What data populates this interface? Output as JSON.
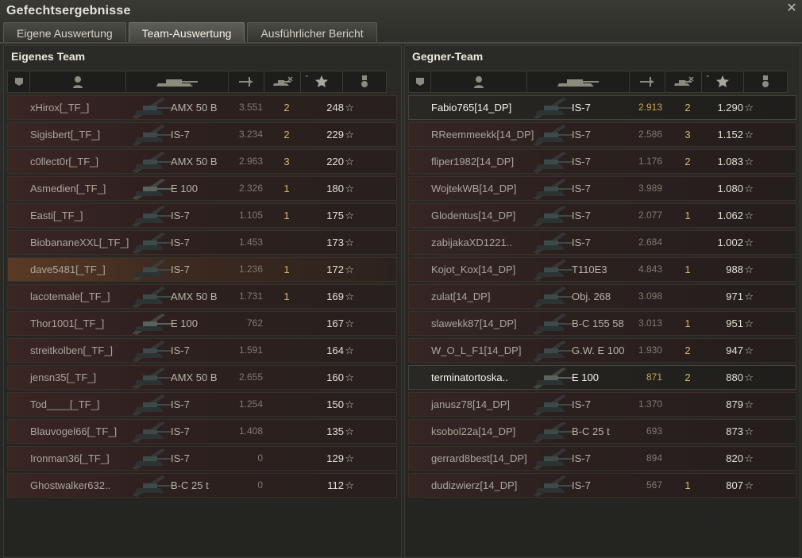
{
  "window": {
    "title": "Gefechtsergebnisse",
    "close_icon": "close-icon"
  },
  "tabs": [
    {
      "label": "Eigene Auswertung",
      "active": false
    },
    {
      "label": "Team-Auswertung",
      "active": true
    },
    {
      "label": "Ausführlicher Bericht",
      "active": false
    }
  ],
  "columns": [
    "squad-icon",
    "player-icon",
    "tank-icon",
    "damage-icon",
    "kills-icon",
    "experience-star-icon",
    "medal-icon"
  ],
  "own_team": {
    "title": "Eigenes Team",
    "rows": [
      {
        "name": "xHirox[_TF_]",
        "tank": "AMX 50 B",
        "damage": "3.551",
        "kills": "2",
        "xp": "248"
      },
      {
        "name": "Sigisbert[_TF_]",
        "tank": "IS-7",
        "damage": "3.234",
        "kills": "2",
        "xp": "229"
      },
      {
        "name": "c0llect0r[_TF_]",
        "tank": "AMX 50 B",
        "damage": "2.963",
        "kills": "3",
        "xp": "220"
      },
      {
        "name": "Asmedien[_TF_]",
        "tank": "E 100",
        "damage": "2.326",
        "kills": "1",
        "xp": "180"
      },
      {
        "name": "Easti[_TF_]",
        "tank": "IS-7",
        "damage": "1.105",
        "kills": "1",
        "xp": "175"
      },
      {
        "name": "BiobananeXXL[_TF_]",
        "tank": "IS-7",
        "damage": "1.453",
        "kills": "",
        "xp": "173"
      },
      {
        "name": "dave5481[_TF_]",
        "tank": "IS-7",
        "damage": "1.236",
        "kills": "1",
        "xp": "172",
        "highlight": true
      },
      {
        "name": "lacotemale[_TF_]",
        "tank": "AMX 50 B",
        "damage": "1.731",
        "kills": "1",
        "xp": "169"
      },
      {
        "name": "Thor1001[_TF_]",
        "tank": "E 100",
        "damage": "762",
        "kills": "",
        "xp": "167"
      },
      {
        "name": "streitkolben[_TF_]",
        "tank": "IS-7",
        "damage": "1.591",
        "kills": "",
        "xp": "164"
      },
      {
        "name": "jensn35[_TF_]",
        "tank": "AMX 50 B",
        "damage": "2.655",
        "kills": "",
        "xp": "160"
      },
      {
        "name": "Tod____[_TF_]",
        "tank": "IS-7",
        "damage": "1.254",
        "kills": "",
        "xp": "150"
      },
      {
        "name": "Blauvogel66[_TF_]",
        "tank": "IS-7",
        "damage": "1.408",
        "kills": "",
        "xp": "135"
      },
      {
        "name": "Ironman36[_TF_]",
        "tank": "IS-7",
        "damage": "0",
        "kills": "",
        "xp": "129"
      },
      {
        "name": "Ghostwalker632..",
        "tank": "B-C 25 t",
        "damage": "0",
        "kills": "",
        "xp": "112"
      }
    ]
  },
  "enemy_team": {
    "title": "Gegner-Team",
    "rows": [
      {
        "name": "Fabio765[14_DP]",
        "tank": "IS-7",
        "damage": "2.913",
        "kills": "2",
        "xp": "1.290",
        "player": true
      },
      {
        "name": "RReemmeekk[14_DP]",
        "tank": "IS-7",
        "damage": "2.586",
        "kills": "3",
        "xp": "1.152"
      },
      {
        "name": "fliper1982[14_DP]",
        "tank": "IS-7",
        "damage": "1.176",
        "kills": "2",
        "xp": "1.083"
      },
      {
        "name": "WojtekWB[14_DP]",
        "tank": "IS-7",
        "damage": "3.989",
        "kills": "",
        "xp": "1.080"
      },
      {
        "name": "Glodentus[14_DP]",
        "tank": "IS-7",
        "damage": "2.077",
        "kills": "1",
        "xp": "1.062"
      },
      {
        "name": "zabijakaXD1221..",
        "tank": "IS-7",
        "damage": "2.684",
        "kills": "",
        "xp": "1.002"
      },
      {
        "name": "Kojot_Kox[14_DP]",
        "tank": "T110E3",
        "damage": "4.843",
        "kills": "1",
        "xp": "988"
      },
      {
        "name": "zulat[14_DP]",
        "tank": "Obj. 268",
        "damage": "3.098",
        "kills": "",
        "xp": "971"
      },
      {
        "name": "slawekk87[14_DP]",
        "tank": "B-C 155 58",
        "damage": "3.013",
        "kills": "1",
        "xp": "951"
      },
      {
        "name": "W_O_L_F1[14_DP]",
        "tank": "G.W. E 100",
        "damage": "1.930",
        "kills": "2",
        "xp": "947"
      },
      {
        "name": "terminatortoska..",
        "tank": "E 100",
        "damage": "871",
        "kills": "2",
        "xp": "880",
        "player": true
      },
      {
        "name": "janusz78[14_DP]",
        "tank": "IS-7",
        "damage": "1.370",
        "kills": "",
        "xp": "879"
      },
      {
        "name": "ksobol22a[14_DP]",
        "tank": "B-C 25 t",
        "damage": "693",
        "kills": "",
        "xp": "873"
      },
      {
        "name": "gerrard8best[14_DP]",
        "tank": "IS-7",
        "damage": "894",
        "kills": "",
        "xp": "820"
      },
      {
        "name": "dudizwierz[14_DP]",
        "tank": "IS-7",
        "damage": "567",
        "kills": "1",
        "xp": "807"
      }
    ]
  },
  "colors": {
    "accent_gold": "#c9a65a",
    "row_red": "#3a2624",
    "highlight_orange": "#5a3a26"
  }
}
